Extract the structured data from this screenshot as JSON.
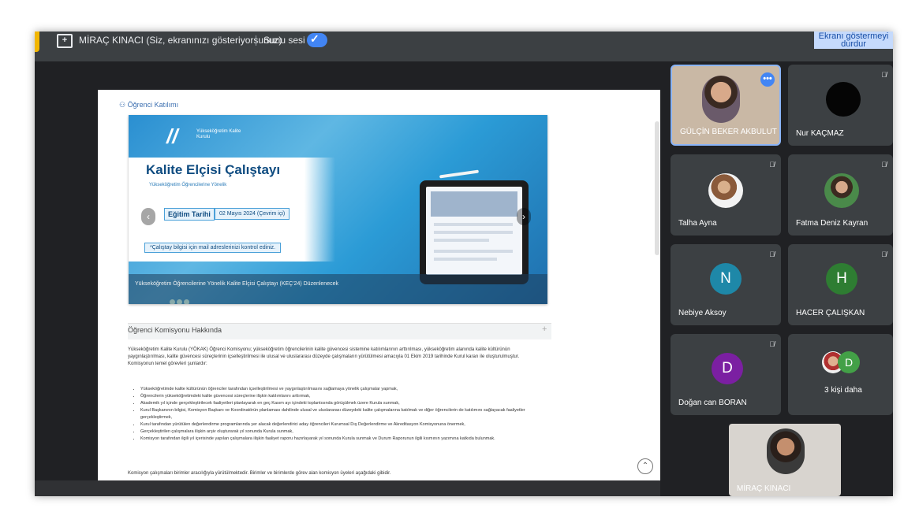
{
  "topbar": {
    "share_text": "MİRAÇ KINACI (Siz, ekranınızı gösteriyorsunuz)",
    "audio_label": "Sunu sesi",
    "stop_button": "Ekranı göstermeyi durdur",
    "share_icon": "present-icon",
    "toggle_icon": "check-icon"
  },
  "doc": {
    "section_title": "Öğrenci Katılımı",
    "banner": {
      "org": "Yükseköğretim Kalite Kurulu",
      "title": "Kalite Elçisi Çalıştayı",
      "subtitle": "Yükseköğretim Öğrencilerine Yönelik",
      "date_label": "Eğitim Tarihi",
      "date_value": "02 Mayıs 2024 (Çevrim içi)",
      "note": "*Çalıştay bilgisi için mail adreslerinizi kontrol ediniz.",
      "caption": "Yükseköğretim Öğrencilerine Yönelik Kalite Elçisi Çalıştayı (KEÇ'24) Düzenlenecek"
    },
    "accordion_title": "Öğrenci Komisyonu Hakkında",
    "paragraph": "Yükseköğretim Kalite Kurulu (YÖKAK) Öğrenci Komisyonu; yükseköğretim öğrencilerinin kalite güvencesi sistemine katılımlarının arttırılması, yükseköğretim alanında kalite kültürünün yaygınlaştırılması, kalite güvencesi süreçlerinin içselleştirilmesi ile ulusal ve uluslararası düzeyde çalışmaların yürütülmesi amacıyla 01 Ekim 2019 tarihinde Kurul kararı ile oluşturulmuştur. Komisyonun temel görevleri şunlardır:",
    "bullets": [
      "Yükseköğretimde kalite kültürünün öğrenciler tarafından içselleştirilmesi ve yaygınlaştırılmasını sağlamaya yönelik çalışmalar yapmak,",
      "Öğrencilerin yükseköğretimdeki kalite güvencesi süreçlerine ilişkin katılımlarını arttırmak,",
      "Akademik yıl içinde gerçekleştirilecek faaliyetleri planlayarak en geç Kasım ayı içindeki toplantısında görüşülmek üzere Kurula sunmak,",
      "Kurul Başkanının bilgisi, Komisyon Başkanı ve Koordinatörün planlaması dahilinde ulusal ve uluslararası düzeydeki kalite çalışmalarına katılmak ve diğer öğrencilerin de katılımını sağlayacak faaliyetler gerçekleştirmek,",
      "Kurul tarafından yürütülen değerlendirme programlarında yer alacak değerlendirici aday öğrencileri Kurumsal Dış Değerlendirme ve Akreditasyon Komisyonuna önermek,",
      "Gerçekleştirilen çalışmalara ilişkin arşiv oluşturarak yıl sonunda Kurula sunmak,",
      "Komisyon tarafından ilgili yıl içerisinde yapılan çalışmalara ilişkin faaliyet raporu hazırlayarak yıl sonunda Kurula sunmak ve Durum Raporunun ilgili kısmının yazımına katkıda bulunmak."
    ],
    "footer": "Komisyon çalışmaları birimler aracılığıyla yürütülmektedir. Birimler ve birimlerde görev alan komisyon üyeleri aşağıdaki gibidir."
  },
  "participants": [
    {
      "name": "GÜLÇİN BEKER AKBULUT",
      "type": "photo"
    },
    {
      "name": "Nur KAÇMAZ",
      "type": "dark-avatar"
    },
    {
      "name": "Talha Ayna",
      "type": "photo"
    },
    {
      "name": "Fatma Deniz Kayran",
      "type": "photo"
    },
    {
      "name": "Nebiye Aksoy",
      "initial": "N",
      "color": "#1e88a8"
    },
    {
      "name": "HACER ÇALIŞKAN",
      "initial": "H",
      "color": "#2e7d32"
    },
    {
      "name": "Doğan can BORAN",
      "initial": "D",
      "color": "#7b1fa2"
    },
    {
      "name": "3 kişi daha",
      "initial": "D",
      "color": "#43a047"
    },
    {
      "name": "MİRAÇ KINACI",
      "type": "self-view"
    }
  ]
}
